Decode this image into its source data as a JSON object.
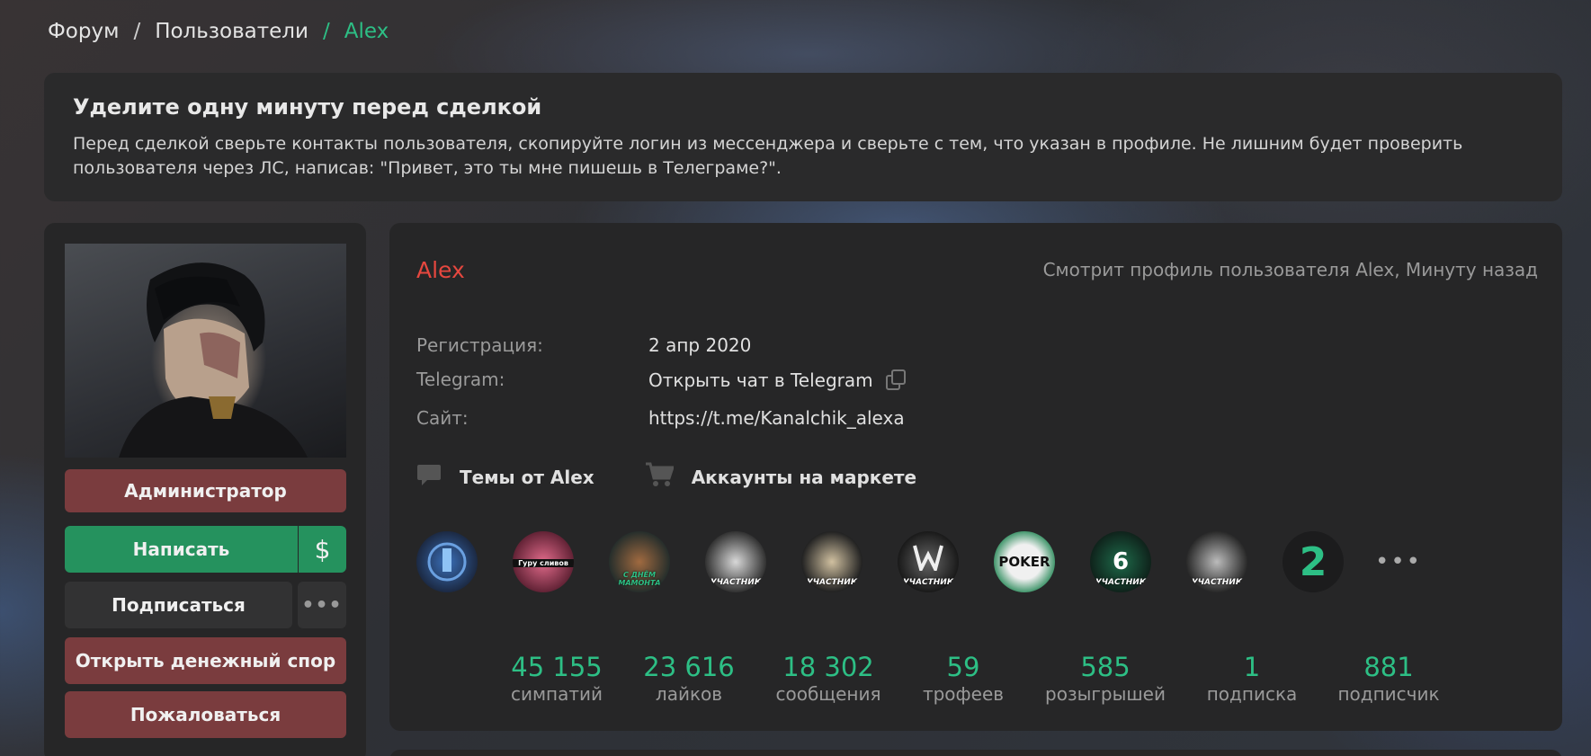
{
  "breadcrumb": {
    "items": [
      "Форум",
      "Пользователи"
    ],
    "separator": "/",
    "current": "Alex"
  },
  "notice": {
    "title": "Уделите одну минуту перед сделкой",
    "text_line1": "Перед сделкой сверьте контакты пользователя, скопируйте логин из мессенджера и сверьте с тем, что указан в профиле. Не лишним будет проверить",
    "text_line2": "пользователя через ЛС, написав: \"Привет, это ты мне пишешь в Телеграме?\"."
  },
  "sidebar": {
    "role_label": "Администратор",
    "write_label": "Написать",
    "dollar_label": "$",
    "subscribe_label": "Подписаться",
    "more_label": "•••",
    "dispute_label": "Открыть денежный спор",
    "report_label": "Пожаловаться"
  },
  "profile": {
    "username": "Alex",
    "viewing_status": "Смотрит профиль пользователя Alex, Минуту назад",
    "registration_label": "Регистрация:",
    "registration_value": "2 апр 2020",
    "telegram_label": "Telegram:",
    "telegram_value": "Открыть чат в Telegram",
    "site_label": "Сайт:",
    "site_value": "https://t.me/Kanalchik_alexa",
    "topics_link": "Темы от Alex",
    "market_link": "Аккаунты на маркете"
  },
  "trophies": [
    {
      "icon": "trophy-award-icon",
      "caption": ""
    },
    {
      "icon": "trophy-guru-icon",
      "caption": "Гуру сливов"
    },
    {
      "icon": "trophy-mammoth-icon",
      "caption": "С ДНЁМ МАМОНТА"
    },
    {
      "icon": "trophy-clash-royale-icon",
      "caption": "УЧАСТНИК"
    },
    {
      "icon": "trophy-monopoly-icon",
      "caption": "УЧАСТНИК"
    },
    {
      "icon": "trophy-warface-icon",
      "caption": "УЧАСТНИК"
    },
    {
      "icon": "trophy-poker-icon",
      "caption": "POKER"
    },
    {
      "icon": "trophy-rainbow-six-icon",
      "caption": "УЧАСТНИК"
    },
    {
      "icon": "trophy-roblox-icon",
      "caption": "УЧАСТНИК"
    },
    {
      "icon": "trophy-curator-icon",
      "caption": "2"
    }
  ],
  "trophies_more": "•••",
  "stats": [
    {
      "value": "45 155",
      "label": "симпатий"
    },
    {
      "value": "23 616",
      "label": "лайков"
    },
    {
      "value": "18 302",
      "label": "сообщения"
    },
    {
      "value": "59",
      "label": "трофеев"
    },
    {
      "value": "585",
      "label": "розыгрышей"
    },
    {
      "value": "1",
      "label": "подписка"
    },
    {
      "value": "881",
      "label": "подписчик"
    }
  ],
  "colors": {
    "accent_green": "#2dbf85",
    "username_red": "#e5473f",
    "button_red": "#7a3c3e",
    "button_green": "#25925e"
  }
}
